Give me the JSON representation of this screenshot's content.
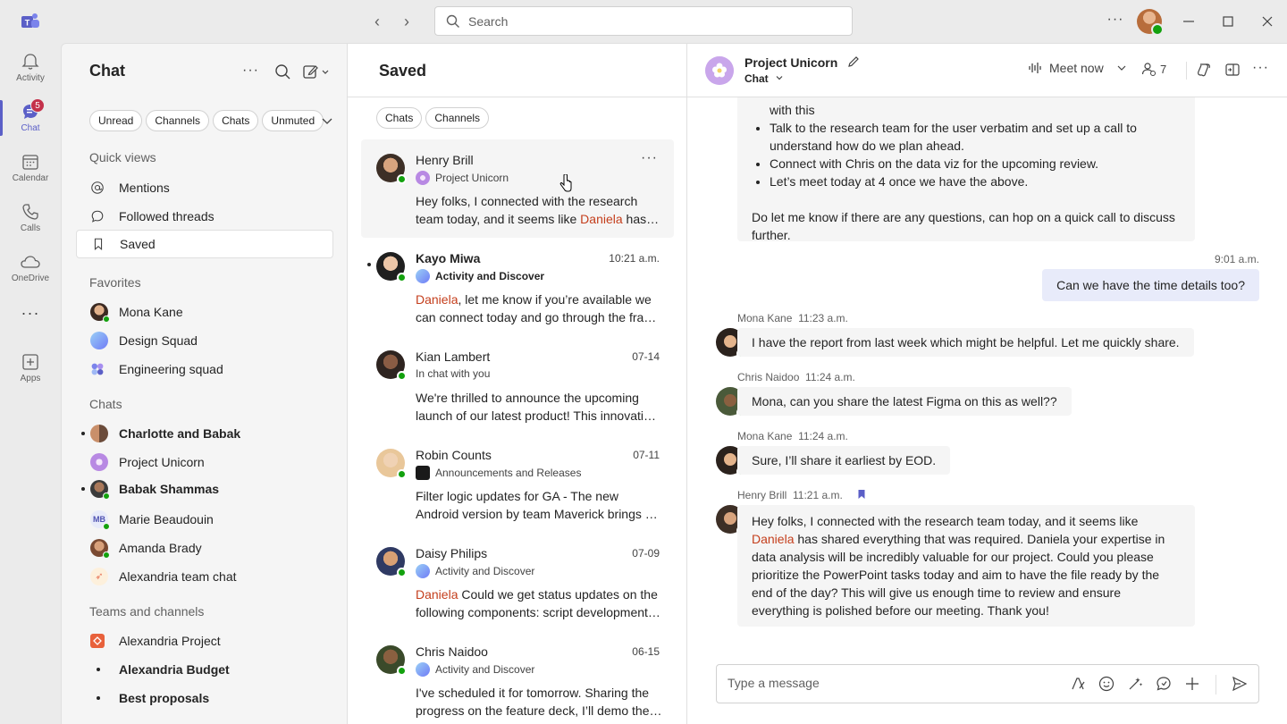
{
  "titlebar": {
    "search_placeholder": "Search"
  },
  "rail": {
    "items": [
      {
        "label": "Activity",
        "icon": "bell-icon"
      },
      {
        "label": "Chat",
        "icon": "chat-icon",
        "badge": "5"
      },
      {
        "label": "Calendar",
        "icon": "calendar-icon"
      },
      {
        "label": "Calls",
        "icon": "phone-icon"
      },
      {
        "label": "OneDrive",
        "icon": "cloud-icon"
      },
      {
        "label": "Apps",
        "icon": "add-apps-icon"
      }
    ]
  },
  "chat_panel": {
    "title": "Chat",
    "filters": [
      "Unread",
      "Channels",
      "Chats",
      "Unmuted"
    ],
    "quick_views_header": "Quick views",
    "quick_views": [
      "Mentions",
      "Followed threads",
      "Saved"
    ],
    "favorites_header": "Favorites",
    "favorites": [
      "Mona Kane",
      "Design Squad",
      "Engineering squad"
    ],
    "chats_header": "Chats",
    "chats": [
      "Charlotte and Babak",
      "Project Unicorn",
      "Babak Shammas",
      "Marie Beaudouin",
      "Amanda Brady",
      "Alexandria team chat"
    ],
    "mb_initials": "MB",
    "teams_header": "Teams and channels",
    "teams": [
      "Alexandria Project",
      "Alexandria Budget",
      "Best proposals"
    ]
  },
  "saved_panel": {
    "title": "Saved",
    "filters": [
      "Chats",
      "Channels"
    ],
    "items": [
      {
        "name": "Henry Brill",
        "time": "",
        "context": "Project Unicorn",
        "msg1": "Hey folks, I connected with the research",
        "msg2_pre": "team today, and it seems like ",
        "msg2_mention": "Daniela",
        "msg2_post": " has shared everything that was required."
      },
      {
        "name": "Kayo Miwa",
        "time": "10:21 a.m.",
        "context": "Activity and Discover",
        "msg1_mention": "Daniela",
        "msg1_post": ", let me know if you’re available we",
        "msg2": "can connect today and go through the framework."
      },
      {
        "name": "Kian Lambert",
        "time": "07-14",
        "context": "In chat with you",
        "msg1": "We're thrilled to announce the upcoming",
        "msg2": "launch of our latest product! This innovation will."
      },
      {
        "name": "Robin Counts",
        "time": "07-11",
        "context": "Announcements and Releases",
        "msg1": "Filter logic updates for GA - The new",
        "msg2": "Android version by team Maverick brings new features."
      },
      {
        "name": "Daisy Philips",
        "time": "07-09",
        "context": "Activity and Discover",
        "msg1_mention": "Daniela",
        "msg1_post": " Could we get status updates on the",
        "msg2": "following components: script development and review."
      },
      {
        "name": "Chris Naidoo",
        "time": "06-15",
        "context": "Activity and Discover",
        "msg1": "I've scheduled it for tomorrow. Sharing the",
        "msg2": "progress on the feature deck, I’ll demo the flow."
      }
    ]
  },
  "conversation": {
    "title": "Project Unicorn",
    "subtitle": "Chat",
    "meet_now": "Meet now",
    "participants": "7",
    "first_bubble": {
      "line0": "with this",
      "bullets": [
        "Talk to the research team for the user verbatim and set up a call to understand how do we plan ahead.",
        "Connect with Chris on the data viz for the upcoming review.",
        "Let’s meet today at 4 once we have the above."
      ],
      "closing": "Do let me know if there are any questions, can hop on a quick call to discuss further."
    },
    "my_msg": {
      "time": "9:01 a.m.",
      "text": "Can we have the time details too?"
    },
    "messages": [
      {
        "author": "Mona Kane",
        "time": "11:23 a.m.",
        "text": "I have the report from last week which might be helpful. Let me quickly share."
      },
      {
        "author": "Chris Naidoo",
        "time": "11:24 a.m.",
        "text": "Mona, can you share the latest Figma on this as well??"
      },
      {
        "author": "Mona Kane",
        "time": "11:24 a.m.",
        "text": "Sure, I’ll share it earliest by EOD."
      }
    ],
    "henry_msg": {
      "author": "Henry Brill",
      "time": "11:21 a.m.",
      "line1": "Hey folks, I connected with the research team today, and it seems like",
      "mention": "Daniela",
      "line2_post": " has shared everything that was required. Daniela your expertise in",
      "rest": "data analysis will be incredibly valuable for our project. Could you please prioritize the PowerPoint tasks today and aim to have the file ready by the end of the day? This will give us enough time to review and ensure everything is polished before our meeting. Thank you!"
    },
    "composer_placeholder": "Type a message"
  },
  "colors": {
    "brand": "#5b5fc7",
    "mention": "#c43e1c",
    "presence_available": "#13a10e",
    "badge": "#c4314b"
  }
}
